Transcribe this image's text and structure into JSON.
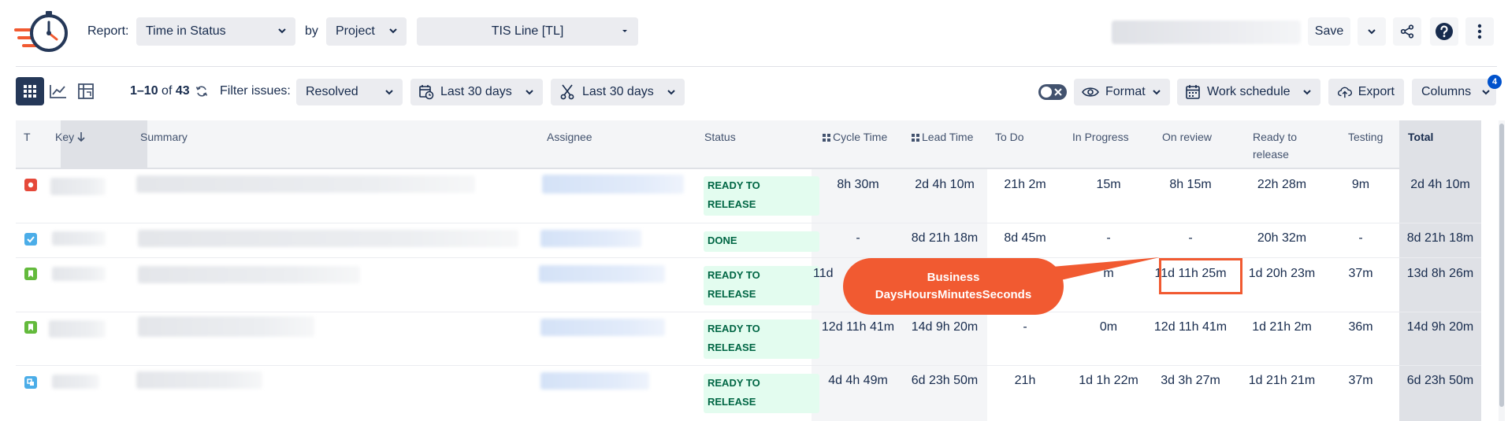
{
  "header": {
    "report_label": "Report:",
    "report_value": "Time in Status",
    "by_label": "by",
    "group_value": "Project",
    "project_value": "TIS Line [TL]",
    "save_label": "Save"
  },
  "toolbar": {
    "range": "1–10",
    "of": "of",
    "total": "43",
    "filter_label": "Filter issues:",
    "filter_value": "Resolved",
    "date_filter_1": "Last 30 days",
    "date_filter_2": "Last 30 days",
    "format_label": "Format",
    "schedule_label": "Work schedule",
    "export_label": "Export",
    "columns_label": "Columns",
    "columns_badge": "4"
  },
  "table": {
    "headers": {
      "type": "T",
      "key": "Key",
      "summary": "Summary",
      "assignee": "Assignee",
      "status": "Status",
      "cycle": "Cycle Time",
      "lead": "Lead Time",
      "todo": "To Do",
      "inprogress": "In Progress",
      "onreview": "On review",
      "ready_line1": "Ready to",
      "ready_line2": "release",
      "testing": "Testing",
      "total": "Total"
    },
    "rows": [
      {
        "type_color": "#e5493a",
        "status_l1": "READY TO",
        "status_l2": "RELEASE",
        "cycle": "8h 30m",
        "lead": "2d 4h 10m",
        "todo": "21h 2m",
        "inprogress": "15m",
        "onreview": "8h 15m",
        "ready": "22h 28m",
        "testing": "9m",
        "total": "2d 4h 10m"
      },
      {
        "type_color": "#4bade8",
        "status_l1": "DONE",
        "status_l2": "",
        "cycle": "-",
        "lead": "8d 21h 18m",
        "todo": "8d 45m",
        "inprogress": "-",
        "onreview": "-",
        "ready": "20h 32m",
        "testing": "-",
        "total": "8d 21h 18m"
      },
      {
        "type_color": "#63ba3c",
        "status_l1": "READY TO",
        "status_l2": "RELEASE",
        "cycle": "11d",
        "lead": "",
        "todo": "",
        "inprogress": "m",
        "onreview": "11d 11h 25m",
        "ready": "1d 20h 23m",
        "testing": "37m",
        "total": "13d 8h 26m"
      },
      {
        "type_color": "#63ba3c",
        "status_l1": "READY TO",
        "status_l2": "RELEASE",
        "cycle": "12d 11h 41m",
        "lead": "14d 9h 20m",
        "todo": "-",
        "inprogress": "0m",
        "onreview": "12d 11h 41m",
        "ready": "1d 21h 2m",
        "testing": "36m",
        "total": "14d 9h 20m"
      },
      {
        "type_color": "#4bade8",
        "status_l1": "READY TO",
        "status_l2": "RELEASE",
        "cycle": "4d 4h 49m",
        "lead": "6d 23h 50m",
        "todo": "21h",
        "inprogress": "1d 1h 22m",
        "onreview": "3d 3h 27m",
        "ready": "1d 21h 21m",
        "testing": "37m",
        "total": "6d 23h 50m"
      }
    ]
  },
  "callout": {
    "line1": "Business",
    "line2": "DaysHoursMinutesSeconds"
  },
  "colors": {
    "accent": "#f15a31",
    "status_bg": "#e3fcef",
    "status_text": "#006644"
  }
}
